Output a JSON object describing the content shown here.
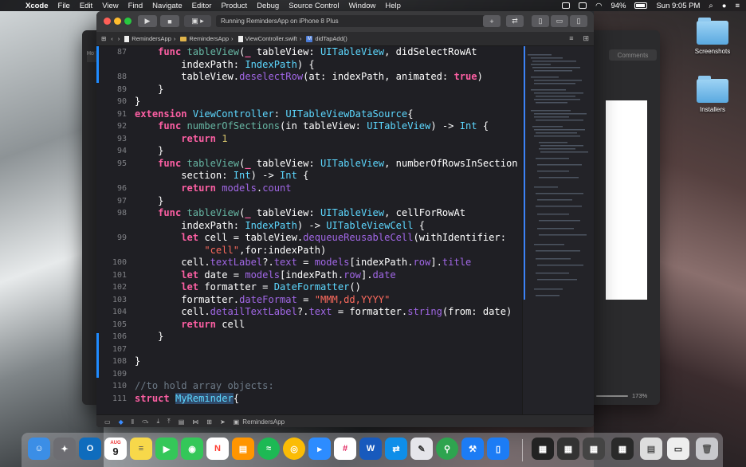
{
  "menubar": {
    "app_name": "Xcode",
    "menus": [
      "File",
      "Edit",
      "View",
      "Find",
      "Navigate",
      "Editor",
      "Product",
      "Debug",
      "Source Control",
      "Window",
      "Help"
    ],
    "battery": "94%",
    "clock": "Sun 9:05 PM"
  },
  "toolbar": {
    "status_text": "Running RemindersApp on iPhone 8 Plus"
  },
  "jumpbar": {
    "crumbs": [
      "RemindersApp",
      "RemindersApp",
      "ViewController.swift",
      "didTapAdd()"
    ]
  },
  "background_window": {
    "tab_label": "Ho",
    "comments_label": "Comments",
    "zoom": "173%"
  },
  "editor": {
    "line_numbers": [
      "87",
      "",
      "88",
      "89",
      "90",
      "91",
      "92",
      "93",
      "94",
      "95",
      "",
      "96",
      "97",
      "98",
      "",
      "99",
      "",
      "100",
      "101",
      "102",
      "103",
      "104",
      "105",
      "106",
      "107",
      "108",
      "109",
      "110",
      "111"
    ]
  },
  "debugbar": {
    "scheme": "RemindersApp"
  },
  "desktop": {
    "icons": [
      {
        "label": "Screenshots",
        "icon": "folder-icon"
      },
      {
        "label": "Installers",
        "icon": "folder-icon"
      }
    ]
  },
  "dock": {
    "calendar_month": "AUG",
    "calendar_day": "9"
  },
  "colors": {
    "keyword": "#fc5fa3",
    "type": "#5dd8ff",
    "function": "#67b7a4",
    "property": "#a167e6",
    "number": "#d0bf69",
    "string": "#fc6a5d",
    "comment": "#6c7986",
    "editor_bg": "#1f1f24"
  }
}
